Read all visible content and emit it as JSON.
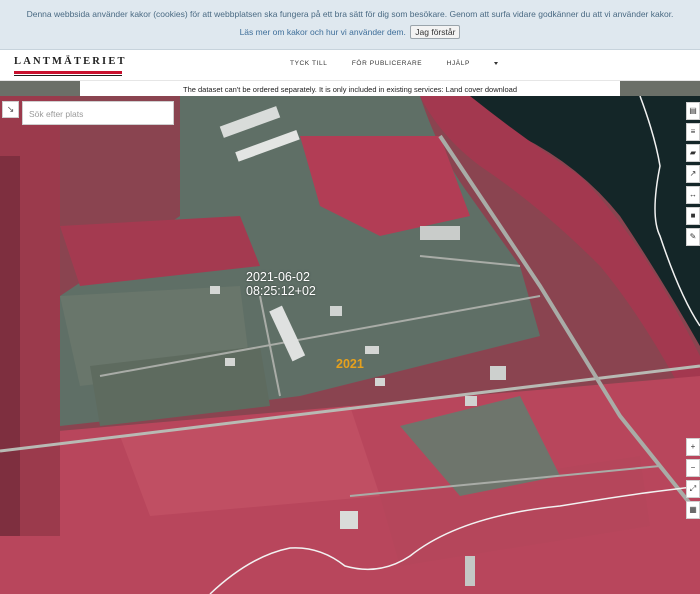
{
  "cookie": {
    "text1": "Denna webbsida använder kakor (cookies) för att webbplatsen ska fungera på ett bra sätt för dig som besökare. Genom att surfa vidare godkänner du att vi använder kakor.",
    "link": "Läs mer om kakor och hur vi använder dem.",
    "button": "Jag förstår"
  },
  "navbar": {
    "logo": "LANTMÄTERIET",
    "links": [
      "TYCK TILL",
      "FÖR PUBLICERARE",
      "HJÄLP"
    ]
  },
  "notice": "The dataset can't be ordered separately. It is only included in existing services: Land cover download",
  "search": {
    "placeholder": "Sök efter plats"
  },
  "map": {
    "date": "2021-06-02",
    "time": "08:25:12+02",
    "year": "2021"
  },
  "toolbar": {
    "icons": [
      "layers-stack-icon",
      "list-icon",
      "eraser-icon",
      "share-icon",
      "measure-icon",
      "stop-icon",
      "pencil-icon"
    ],
    "zoom_in": "+",
    "zoom_out": "−"
  }
}
